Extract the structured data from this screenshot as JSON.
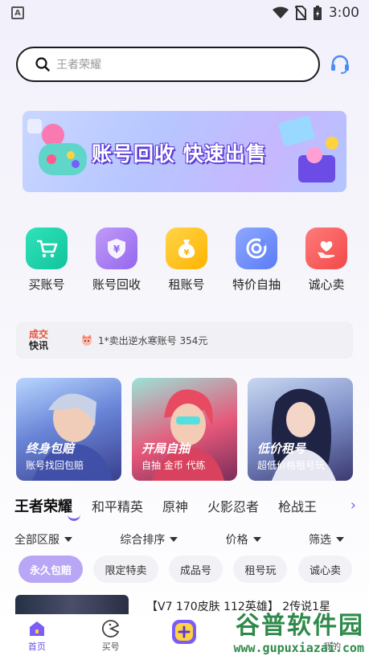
{
  "status_bar": {
    "left_badge": "A",
    "time": "3:00"
  },
  "search": {
    "placeholder": "王者荣耀"
  },
  "banner": {
    "title": "账号回收 快速出售"
  },
  "quick_icons": [
    {
      "label": "买账号",
      "icon": "cart-icon",
      "color": "#1ed0a8"
    },
    {
      "label": "账号回收",
      "icon": "shield-yen-icon",
      "color": "#a77bf2"
    },
    {
      "label": "租账号",
      "icon": "money-bag-icon",
      "color": "#ffc021"
    },
    {
      "label": "特价自抽",
      "icon": "spin-icon",
      "color": "#6a8cf7"
    },
    {
      "label": "诚心卖",
      "icon": "heart-hand-icon",
      "color": "#f5595a"
    }
  ],
  "news": {
    "tag_line1": "成交",
    "tag_line2": "快讯",
    "message": "1*卖出逆水寒账号 354元"
  },
  "feature_cards": [
    {
      "title": "终身包赔",
      "subtitle": "账号找回包赔"
    },
    {
      "title": "开局自抽",
      "subtitle": "自抽 金币 代练"
    },
    {
      "title": "低价租号",
      "subtitle": "超低价格租号玩"
    }
  ],
  "game_tabs": [
    "王者荣耀",
    "和平精英",
    "原神",
    "火影忍者",
    "枪战王"
  ],
  "filters": [
    "全部区服",
    "综合排序",
    "价格",
    "筛选"
  ],
  "chips": [
    "永久包赔",
    "限定特卖",
    "成品号",
    "租号玩",
    "诚心卖"
  ],
  "listing": {
    "title": "【V7 170皮肤 112英雄】 2传说1星"
  },
  "bottom_nav": [
    {
      "label": "首页",
      "active": true
    },
    {
      "label": "买号",
      "active": false
    },
    {
      "label": "",
      "active": false
    },
    {
      "label": "",
      "active": false
    },
    {
      "label": "我的",
      "active": false
    }
  ],
  "watermark": {
    "big": "谷普软件园",
    "small": "www.gupuxiazai.com"
  },
  "colors": {
    "accent": "#7b5cf5",
    "news_tag": "#e2553d"
  }
}
